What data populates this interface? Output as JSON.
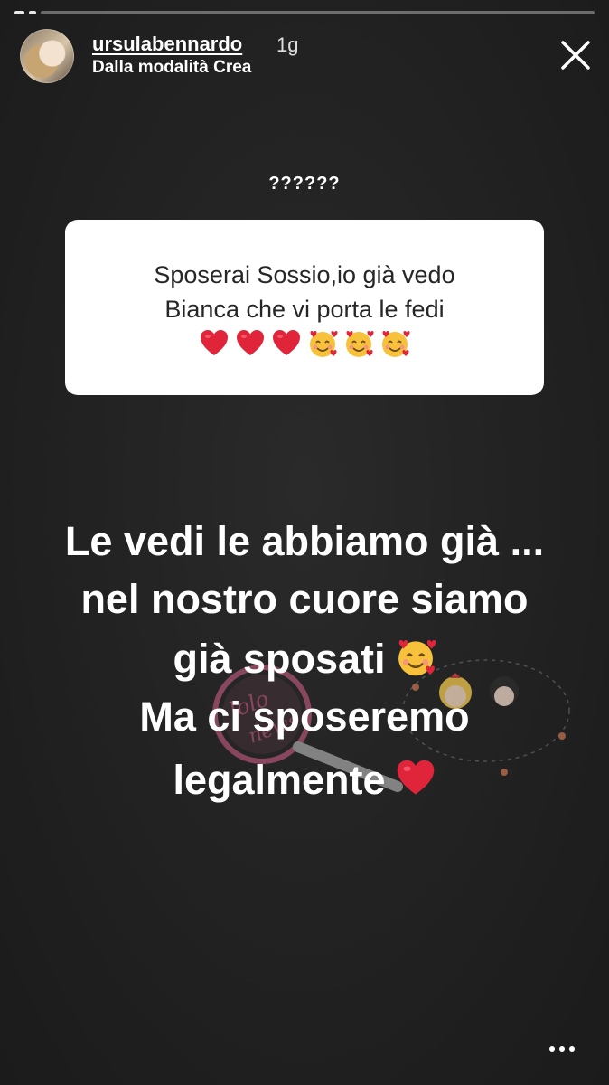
{
  "header": {
    "username": "ursulabennardo",
    "time": "1g",
    "subtitle": "Dalla modalità Crea"
  },
  "question": {
    "header": "??????",
    "line1": "Sposerai Sossio,io già vedo",
    "line2": "Bianca che vi porta le fedi",
    "emojis": [
      "red-heart",
      "red-heart",
      "red-heart",
      "smiling-face-with-hearts",
      "smiling-face-with-hearts",
      "smiling-face-with-hearts"
    ]
  },
  "answer": {
    "line1": "Le vedi le abbiamo già ...",
    "line2": "nel nostro cuore siamo",
    "line3": "già sposati",
    "line4": "Ma ci sposeremo",
    "line5": "legalmente"
  },
  "watermark": {
    "text": "lolonews",
    "logo_text": "gossip dal web"
  },
  "icons": {
    "close": "close-icon",
    "more": "more-options-icon",
    "avatar": "avatar"
  },
  "colors": {
    "background": "#222222",
    "card": "#ffffff",
    "heart": "#e0243a",
    "emoji_face": "#f7c13b",
    "watermark_pink": "#d9638f"
  }
}
